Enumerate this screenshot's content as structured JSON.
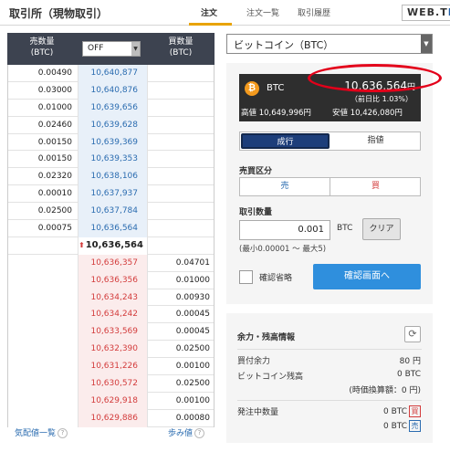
{
  "header": {
    "title": "取引所（現物取引）",
    "tabs": [
      {
        "label": "注文",
        "active": true
      },
      {
        "label": "注文一覧",
        "active": false
      },
      {
        "label": "取引履歴",
        "active": false
      }
    ],
    "logo_text": "WEB.T",
    "logo_accent": "F"
  },
  "orderbook": {
    "sell_header": [
      "売数量",
      "(BTC)"
    ],
    "buy_header": [
      "買数量",
      "(BTC)"
    ],
    "group_select": "OFF",
    "asks": [
      {
        "qty": "0.00490",
        "price": "10,640,877"
      },
      {
        "qty": "0.03000",
        "price": "10,640,876"
      },
      {
        "qty": "0.01000",
        "price": "10,639,656"
      },
      {
        "qty": "0.02460",
        "price": "10,639,628"
      },
      {
        "qty": "0.00150",
        "price": "10,639,369"
      },
      {
        "qty": "0.00150",
        "price": "10,639,353"
      },
      {
        "qty": "0.02320",
        "price": "10,638,106"
      },
      {
        "qty": "0.00010",
        "price": "10,637,937"
      },
      {
        "qty": "0.02500",
        "price": "10,637,784"
      },
      {
        "qty": "0.00075",
        "price": "10,636,564"
      }
    ],
    "mid_price": "10,636,564",
    "bids": [
      {
        "price": "10,636,357",
        "qty": "0.04701"
      },
      {
        "price": "10,636,356",
        "qty": "0.01000"
      },
      {
        "price": "10,634,243",
        "qty": "0.00930"
      },
      {
        "price": "10,634,242",
        "qty": "0.00045"
      },
      {
        "price": "10,633,569",
        "qty": "0.00045"
      },
      {
        "price": "10,632,390",
        "qty": "0.02500"
      },
      {
        "price": "10,631,226",
        "qty": "0.00100"
      },
      {
        "price": "10,630,572",
        "qty": "0.02500"
      },
      {
        "price": "10,629,918",
        "qty": "0.00100"
      },
      {
        "price": "10,629,886",
        "qty": "0.00080"
      }
    ],
    "footer_left": "気配値一覧",
    "footer_right": "歩み値"
  },
  "order": {
    "pair": "ビットコイン（BTC）",
    "ticker": {
      "coin_glyph": "₿",
      "symbol": "BTC",
      "last_price": "10,636,564",
      "currency": "円",
      "change": "（前日比 1.03%）",
      "high_label": "高値",
      "high": "10,649,996円",
      "low_label": "安値",
      "low": "10,426,080円"
    },
    "type_options": {
      "selected": "成行",
      "other": "指値"
    },
    "side_label": "売買区分",
    "side_sell": "売",
    "side_buy": "買",
    "qty_label": "取引数量",
    "qty_value": "0.001",
    "qty_unit": "BTC",
    "clear_label": "クリア",
    "qty_hint": "(最小0.00001 〜 最大5)",
    "confirm_skip_label": "確認省略",
    "confirm_button": "確認画面へ"
  },
  "balance": {
    "title": "余力・残高情報",
    "buying_power_label": "買付余力",
    "buying_power": "80 円",
    "btc_balance_label": "ビットコイン残高",
    "btc_balance": "0 BTC",
    "btc_valuation": "(時価換算額：0 円)",
    "pending_label": "発注中数量",
    "pending_buy": "0 BTC",
    "pending_buy_tag": "買",
    "pending_sell": "0 BTC",
    "pending_sell_tag": "売"
  },
  "colors": {
    "ask_price": "#2b6cb0",
    "bid_price": "#d33c3c",
    "header_bg": "#3d4350",
    "selected_order_type": "#1d3e7a",
    "confirm_button": "#2f8fdd",
    "tab_underline": "#e8a300",
    "highlight_ring": "#e3001a"
  }
}
